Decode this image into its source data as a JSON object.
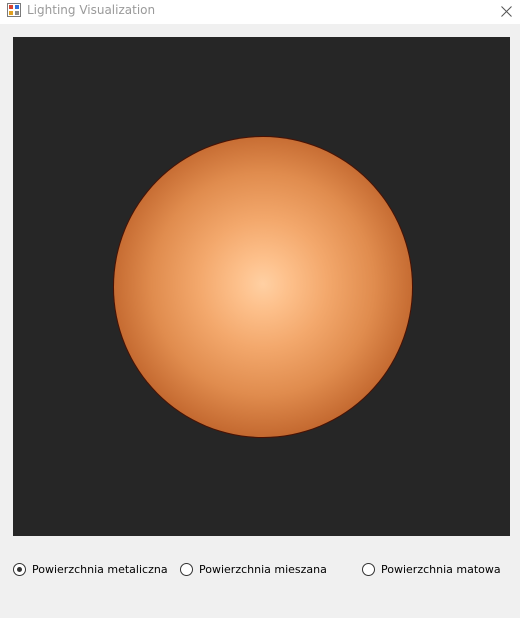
{
  "window": {
    "title": "Lighting Visualization",
    "app_icon": "window-app-icon",
    "close_icon": "close-icon"
  },
  "render": {
    "object": "sphere",
    "colors": {
      "background": "#262626",
      "highlight": "#ffd0a3",
      "mid": "#e08c4e",
      "edge": "#5e1700"
    }
  },
  "surface_options": {
    "selected_index": 0,
    "items": [
      {
        "label": "Powierzchnia metaliczna",
        "checked": true
      },
      {
        "label": "Powierzchnia mieszana",
        "checked": false
      },
      {
        "label": "Powierzchnia matowa",
        "checked": false
      }
    ]
  }
}
